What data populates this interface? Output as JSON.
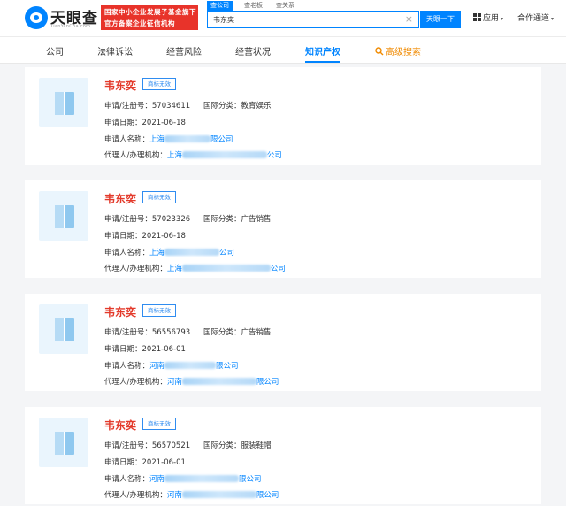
{
  "header": {
    "logo_text": "天眼查",
    "logo_sub": "TianYanCha.com",
    "banner_line1": "国家中小企业发展子基金旗下",
    "banner_line2": "官方备案企业征信机构",
    "search_tabs": [
      "查公司",
      "查老板",
      "查关系"
    ],
    "search_value": "韦东奕",
    "search_clear": "×",
    "search_button": "天眼一下",
    "app_label": "应用",
    "user_label": "合作通道",
    "caret": "▾"
  },
  "nav": {
    "items": [
      "公司",
      "法律诉讼",
      "经营风险",
      "经营状况",
      "知识产权",
      "高级搜索"
    ],
    "search_icon": "search-icon"
  },
  "labels": {
    "reg_no": "申请/注册号：",
    "intl_class": "国际分类：",
    "app_date": "申请日期：",
    "applicant": "申请人名称：",
    "agent": "代理人/办理机构："
  },
  "records": [
    {
      "name": "韦东奕",
      "status": "商标无效",
      "reg_no": "57034611",
      "intl_class": "教育娱乐",
      "app_date": "2021-06-18",
      "applicant_prefix": "上海",
      "applicant_suffix": "限公司",
      "agent_prefix": "上海",
      "agent_suffix": "公司"
    },
    {
      "name": "韦东奕",
      "status": "商标无效",
      "reg_no": "57023326",
      "intl_class": "广告销售",
      "app_date": "2021-06-18",
      "applicant_prefix": "上海",
      "applicant_suffix": "公司",
      "agent_prefix": "上海",
      "agent_suffix": "公司"
    },
    {
      "name": "韦东奕",
      "status": "商标无效",
      "reg_no": "56556793",
      "intl_class": "广告销售",
      "app_date": "2021-06-01",
      "applicant_prefix": "河南",
      "applicant_suffix": "限公司",
      "agent_prefix": "河南",
      "agent_suffix": "限公司"
    },
    {
      "name": "韦东奕",
      "status": "商标无效",
      "reg_no": "56570521",
      "intl_class": "服装鞋帽",
      "app_date": "2021-06-01",
      "applicant_prefix": "河南",
      "applicant_suffix": "限公司",
      "agent_prefix": "河南",
      "agent_suffix": "限公司"
    }
  ],
  "colors": {
    "brand_blue": "#0084ff",
    "trademark_red": "#e33a2b",
    "accent_orange": "#f08a00",
    "banner_red": "#e8332a"
  }
}
